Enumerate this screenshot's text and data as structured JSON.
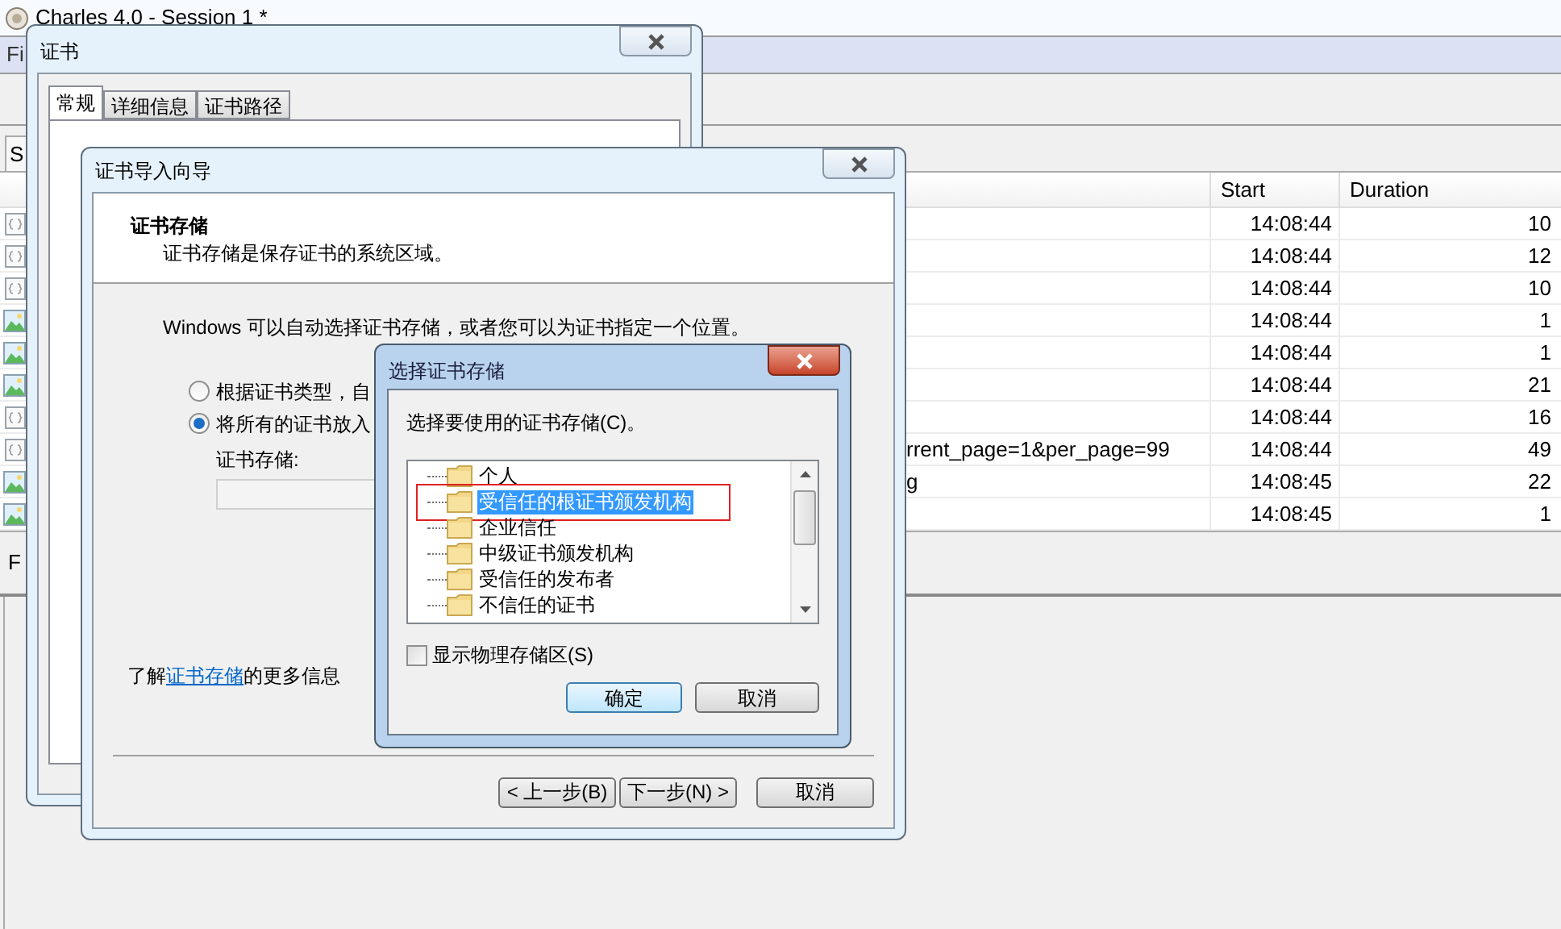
{
  "main_window": {
    "title": "Charles 4.0 - Session 1 *",
    "menu": [
      "Fi"
    ],
    "tab": "S",
    "table": {
      "columns": [
        "Start",
        "Duration"
      ],
      "rows": [
        {
          "kind": "json",
          "start": "14:08:44",
          "duration": "10"
        },
        {
          "kind": "json",
          "start": "14:08:44",
          "duration": "12"
        },
        {
          "kind": "json",
          "start": "14:08:44",
          "duration": "10"
        },
        {
          "kind": "image",
          "start": "14:08:44",
          "duration": "1"
        },
        {
          "kind": "image",
          "start": "14:08:44",
          "duration": "1"
        },
        {
          "kind": "image",
          "start": "14:08:44",
          "duration": "21"
        },
        {
          "kind": "json",
          "start": "14:08:44",
          "duration": "16"
        },
        {
          "kind": "json",
          "path": "rrent_page=1&per_page=99",
          "start": "14:08:44",
          "duration": "49"
        },
        {
          "kind": "image",
          "path": "g",
          "start": "14:08:45",
          "duration": "22"
        },
        {
          "kind": "image",
          "start": "14:08:45",
          "duration": "1"
        }
      ]
    },
    "filter_label": "F"
  },
  "certificate_window": {
    "title": "证书",
    "tabs": [
      {
        "label": "常规",
        "selected": true
      },
      {
        "label": "详细信息",
        "selected": false
      },
      {
        "label": "证书路径",
        "selected": false
      }
    ]
  },
  "import_wizard": {
    "title": "证书导入向导",
    "heading": "证书存储",
    "subheading": "证书存储是保存证书的系统区域。",
    "description": "Windows 可以自动选择证书存储，或者您可以为证书指定一个位置。",
    "options": [
      {
        "label": "根据证书类型，自",
        "selected": false
      },
      {
        "label": "将所有的证书放入",
        "selected": true
      }
    ],
    "store_label": "证书存储:",
    "more_info": {
      "prefix": "了解",
      "link": "证书存储",
      "suffix": "的更多信息"
    },
    "buttons": [
      {
        "label": "< 上一步(B)",
        "default": false
      },
      {
        "label": "下一步(N) >",
        "default": false
      },
      {
        "label": "取消",
        "default": false
      }
    ]
  },
  "store_dialog": {
    "title": "选择证书存储",
    "prompt": "选择要使用的证书存储(C)。",
    "stores": [
      {
        "label": "个人",
        "selected": false
      },
      {
        "label": "受信任的根证书颁发机构",
        "selected": true
      },
      {
        "label": "企业信任",
        "selected": false
      },
      {
        "label": "中级证书颁发机构",
        "selected": false
      },
      {
        "label": "受信任的发布者",
        "selected": false
      },
      {
        "label": "不信任的证书",
        "selected": false
      }
    ],
    "show_physical": {
      "label": "显示物理存储区(S)",
      "checked": false
    },
    "buttons": [
      {
        "label": "确定",
        "default": true
      },
      {
        "label": "取消",
        "default": false
      }
    ]
  }
}
